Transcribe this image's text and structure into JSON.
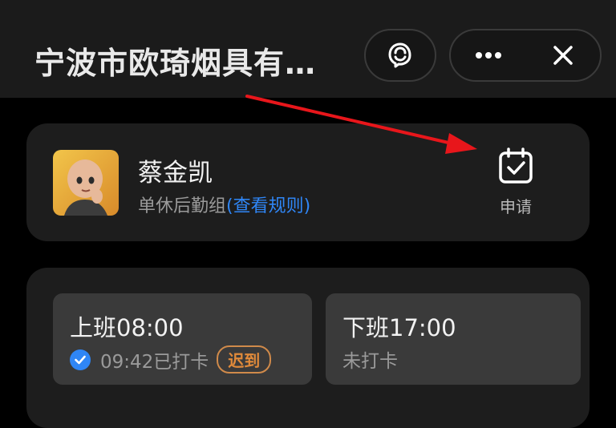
{
  "header": {
    "title": "宁波市欧琦烟具有…"
  },
  "user": {
    "name": "蔡金凯",
    "group": "单休后勤组",
    "rules_link": "(查看规则)",
    "apply_label": "申请"
  },
  "punch": {
    "clock_in": {
      "title": "上班08:00",
      "status": "09:42已打卡",
      "badge": "迟到"
    },
    "clock_out": {
      "title": "下班17:00",
      "status": "未打卡"
    }
  },
  "colors": {
    "accent_blue": "#2f86f6",
    "late_orange": "#e08a3a",
    "annotation_red": "#e8161b"
  }
}
